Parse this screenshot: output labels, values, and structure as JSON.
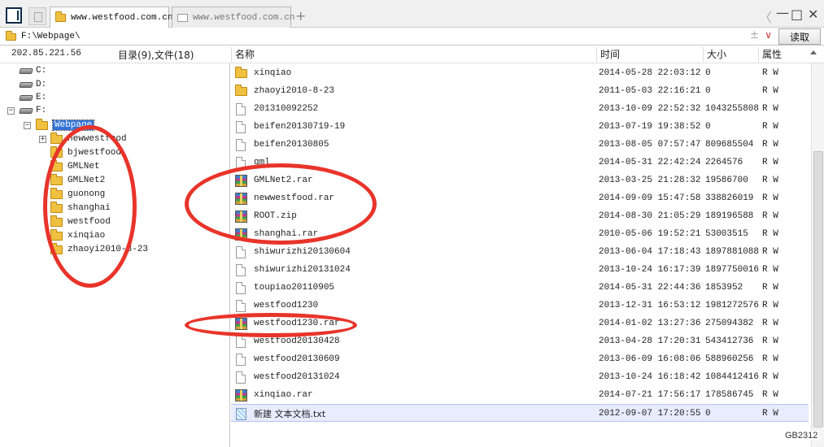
{
  "tabs": [
    {
      "label": "www.westfood.com.cn",
      "active": true
    },
    {
      "label": "www.westfood.com.cn",
      "active": false
    }
  ],
  "new_tab_symbol": "+",
  "window_controls": {
    "back": "〈",
    "minimize": "—",
    "maximize": "□",
    "close": "✕"
  },
  "address": {
    "path": "F:\\Webpage\\",
    "read_button": "读取"
  },
  "header": {
    "ip": "202.85.221.56",
    "counts": "目录(9),文件(18)",
    "columns": {
      "name": "名称",
      "time": "时间",
      "size": "大小",
      "attr": "属性"
    }
  },
  "tree": {
    "drives": [
      "C:",
      "D:",
      "E:",
      "F:"
    ],
    "selected": "Webpage",
    "folders": [
      "newwestfood",
      "bjwestfood",
      "GMLNet",
      "GMLNet2",
      "guonong",
      "shanghai",
      "westfood",
      "xinqiao",
      "zhaoyi2010-8-23"
    ]
  },
  "files": [
    {
      "name": "xinqiao",
      "icon": "folder-icon",
      "time": "2014-05-28 22:03:12",
      "size": "0",
      "attr": "R W"
    },
    {
      "name": "zhaoyi2010-8-23",
      "icon": "folder-icon",
      "time": "2011-05-03 22:16:21",
      "size": "0",
      "attr": "R W"
    },
    {
      "name": "201310092252",
      "icon": "file-icon",
      "time": "2013-10-09 22:52:32",
      "size": "1043255808",
      "attr": "R W"
    },
    {
      "name": "beifen20130719-19",
      "icon": "file-icon",
      "time": "2013-07-19 19:38:52",
      "size": "0",
      "attr": "R W"
    },
    {
      "name": "beifen20130805",
      "icon": "file-icon",
      "time": "2013-08-05 07:57:47",
      "size": "809685504",
      "attr": "R W"
    },
    {
      "name": "gml",
      "icon": "file-icon",
      "time": "2014-05-31 22:42:24",
      "size": "2264576",
      "attr": "R W"
    },
    {
      "name": "GMLNet2.rar",
      "icon": "rar-icon",
      "time": "2013-03-25 21:28:32",
      "size": "19586700",
      "attr": "R W"
    },
    {
      "name": "newwestfood.rar",
      "icon": "rar-icon",
      "time": "2014-09-09 15:47:58",
      "size": "338826019",
      "attr": "R W"
    },
    {
      "name": "ROOT.zip",
      "icon": "rar-icon",
      "time": "2014-08-30 21:05:29",
      "size": "189196588",
      "attr": "R W"
    },
    {
      "name": "shanghai.rar",
      "icon": "rar-icon",
      "time": "2010-05-06 19:52:21",
      "size": "53003515",
      "attr": "R W"
    },
    {
      "name": "shiwurizhi20130604",
      "icon": "file-icon",
      "time": "2013-06-04 17:18:43",
      "size": "1897881088",
      "attr": "R W"
    },
    {
      "name": "shiwurizhi20131024",
      "icon": "file-icon",
      "time": "2013-10-24 16:17:39",
      "size": "1897750016",
      "attr": "R W"
    },
    {
      "name": "toupiao20110905",
      "icon": "file-icon",
      "time": "2014-05-31 22:44:36",
      "size": "1853952",
      "attr": "R W"
    },
    {
      "name": "westfood1230",
      "icon": "file-icon",
      "time": "2013-12-31 16:53:12",
      "size": "1981272576",
      "attr": "R W"
    },
    {
      "name": "westfood1230.rar",
      "icon": "rar-icon",
      "time": "2014-01-02 13:27:36",
      "size": "275094382",
      "attr": "R W"
    },
    {
      "name": "westfood20130428",
      "icon": "file-icon",
      "time": "2013-04-28 17:20:31",
      "size": "543412736",
      "attr": "R W"
    },
    {
      "name": "westfood20130609",
      "icon": "file-icon",
      "time": "2013-06-09 16:08:06",
      "size": "588960256",
      "attr": "R W"
    },
    {
      "name": "westfood20131024",
      "icon": "file-icon",
      "time": "2013-10-24 16:18:42",
      "size": "1084412416",
      "attr": "R W"
    },
    {
      "name": "xinqiao.rar",
      "icon": "rar-icon",
      "time": "2014-07-21 17:56:17",
      "size": "178586745",
      "attr": "R W"
    },
    {
      "name": "新建 文本文档.txt",
      "icon": "txt-icon",
      "time": "2012-09-07 17:20:55",
      "size": "0",
      "attr": "R W",
      "selected": true
    }
  ],
  "status": {
    "encoding": "GB2312"
  },
  "colors": {
    "annotation": "#e8342a",
    "selection": "#3373d6"
  }
}
